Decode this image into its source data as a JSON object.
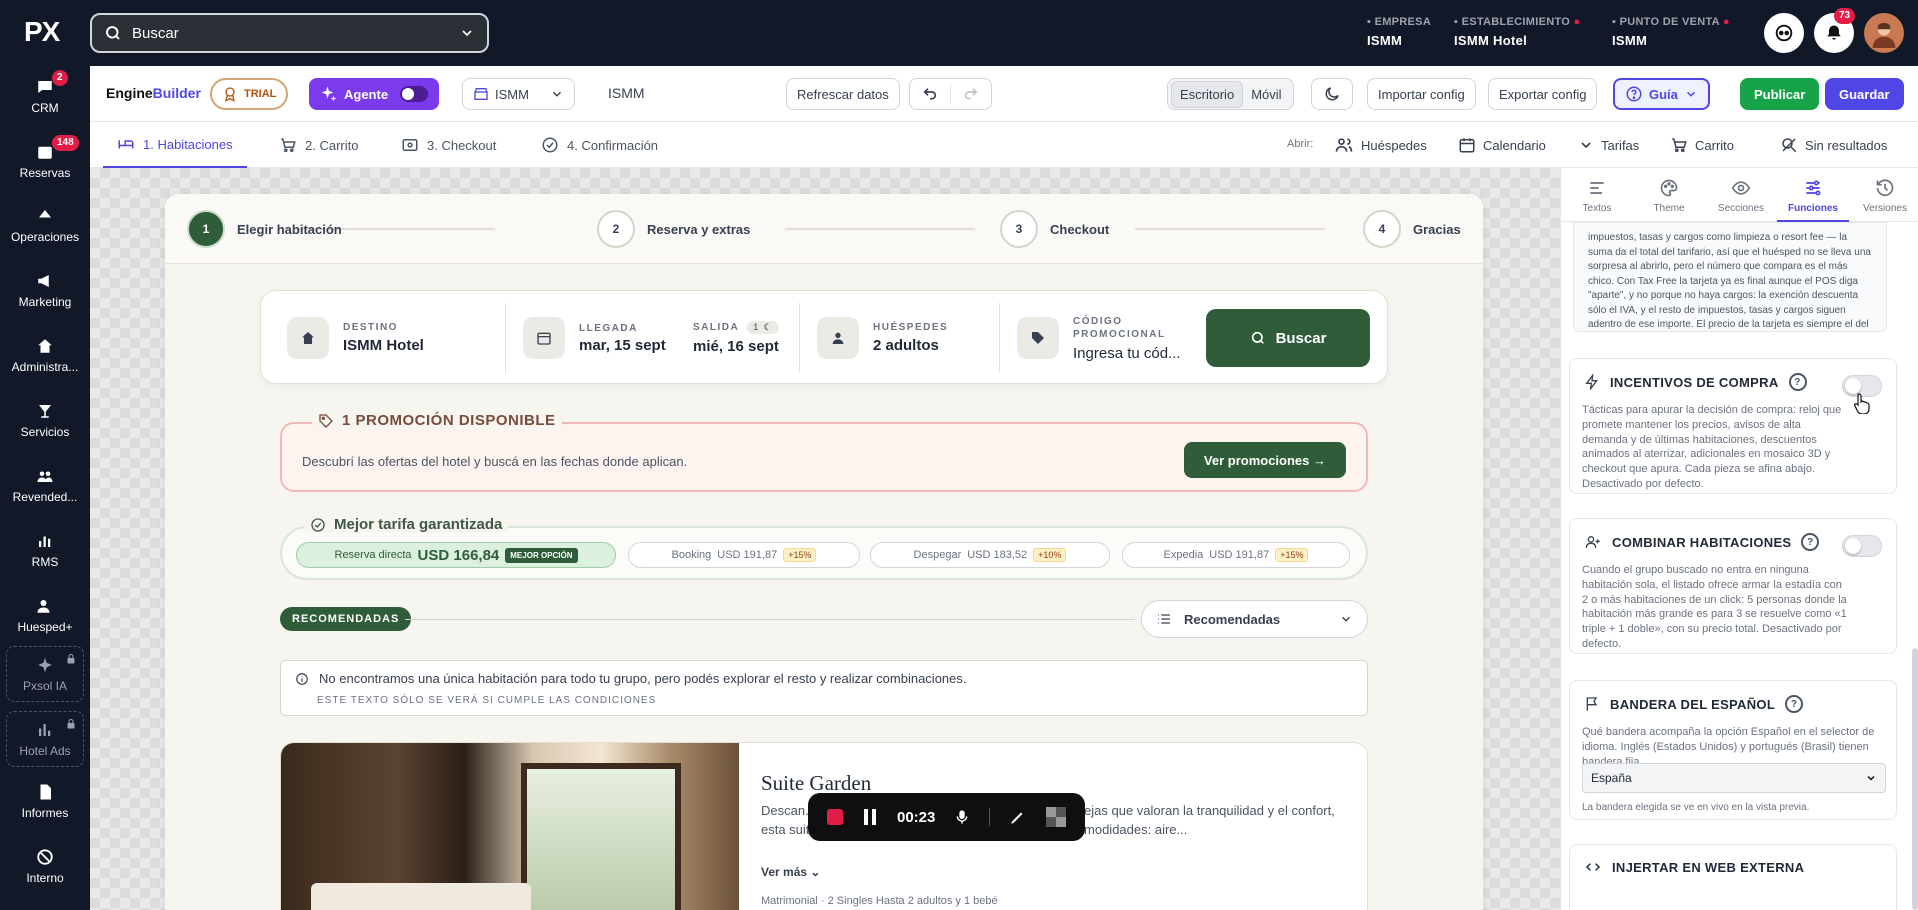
{
  "topbar": {
    "logo": "PX",
    "search_placeholder": "Buscar",
    "empresa_label": "EMPRESA",
    "empresa_value": "ISMM",
    "establecimiento_label": "ESTABLECIMIENTO",
    "establecimiento_value": "ISMM Hotel",
    "pos_label": "PUNTO DE VENTA",
    "pos_value": "ISMM",
    "notifications_count": "73"
  },
  "sidebar": {
    "items": [
      {
        "label": "CRM",
        "badge": "2",
        "icon": "chat-icon"
      },
      {
        "label": "Reservas",
        "badge": "148",
        "icon": "calendar-icon"
      },
      {
        "label": "Operaciones",
        "icon": "bell-icon"
      },
      {
        "label": "Marketing",
        "icon": "megaphone-icon"
      },
      {
        "label": "Administra...",
        "icon": "building-icon"
      },
      {
        "label": "Servicios",
        "icon": "cocktail-icon"
      },
      {
        "label": "Revended...",
        "icon": "users-icon"
      },
      {
        "label": "RMS",
        "icon": "chart-icon"
      },
      {
        "label": "Huesped+",
        "icon": "user-plus-icon"
      },
      {
        "label": "Pxsol IA",
        "icon": "sparkle-icon",
        "locked": true
      },
      {
        "label": "Hotel Ads",
        "icon": "bar-chart-icon",
        "locked": true
      },
      {
        "label": "Informes",
        "icon": "document-icon"
      },
      {
        "label": "Interno",
        "icon": "block-icon"
      }
    ]
  },
  "toolbar": {
    "brand_a": "Engine",
    "brand_b": "Builder",
    "trial": "TRIAL",
    "agent": "Agente",
    "hotel_select": "ISMM",
    "hotel_name": "ISMM",
    "refresh": "Refrescar datos",
    "view_desktop": "Escritorio",
    "view_mobile": "Móvil",
    "import": "Importar config",
    "export": "Exportar config",
    "guide": "Guía",
    "publish": "Publicar",
    "save": "Guardar"
  },
  "stepbar": {
    "tabs": [
      "1. Habitaciones",
      "2. Carrito",
      "3. Checkout",
      "4. Confirmación"
    ],
    "open_label": "Abrir:",
    "open_items": [
      "Huéspedes",
      "Calendario",
      "Tarifas",
      "Carrito",
      "Sin resultados"
    ]
  },
  "preview": {
    "steps": [
      {
        "n": "1",
        "label": "Elegir habitación"
      },
      {
        "n": "2",
        "label": "Reserva y extras"
      },
      {
        "n": "3",
        "label": "Checkout"
      },
      {
        "n": "4",
        "label": "Gracias"
      }
    ],
    "search": {
      "destino_label": "DESTINO",
      "destino_value": "ISMM Hotel",
      "llegada_label": "LLEGADA",
      "llegada_value": "mar, 15 sept",
      "salida_label": "SALIDA",
      "salida_nights": "1",
      "salida_value": "mié, 16 sept",
      "huespedes_label": "HUÉSPEDES",
      "huespedes_value": "2 adultos",
      "codigo_label": "CÓDIGO PROMOCIONAL",
      "codigo_placeholder": "Ingresa tu cód...",
      "button": "Buscar"
    },
    "promo": {
      "title": "1 PROMOCIÓN DISPONIBLE",
      "text": "Descubrí las ofertas del hotel y buscá en las fechas donde aplican.",
      "button": "Ver promociones →"
    },
    "rates": {
      "title": "Mejor tarifa garantizada",
      "direct_label": "Reserva directa",
      "direct_price": "USD 166,84",
      "direct_tag": "MEJOR OPCIÓN",
      "others": [
        {
          "name": "Booking",
          "price": "USD 191,87",
          "pct": "+15%"
        },
        {
          "name": "Despegar",
          "price": "USD 183,52",
          "pct": "+10%"
        },
        {
          "name": "Expedia",
          "price": "USD 191,87",
          "pct": "+15%"
        }
      ]
    },
    "recommended_chip": "RECOMENDADAS",
    "sort_value": "Recomendadas",
    "notice": {
      "line1": "No encontramos una única habitación para todo tu grupo, pero podés explorar el resto y realizar combinaciones.",
      "line2": "ESTE TEXTO SÓLO SE VERÁ SI CUMPLE LAS CONDICIONES"
    },
    "room": {
      "title": "Suite Garden",
      "desc": "Descan... osa habitación de 30 m² con una encant... parejas que valoran la tranquilidad y el confort, esta suite ofrece una atmósfera serena con todas las comodidades: aire...",
      "more": "Ver más",
      "beds": "Matrimonial · 2 Singles   Hasta 2 adultos y 1 bebé"
    },
    "recorder": {
      "time": "00:23"
    }
  },
  "rpanel": {
    "tabs": [
      "Textos",
      "Theme",
      "Secciones",
      "Funciones",
      "Versiones"
    ],
    "taxfree_text": "impuestos, tasas y cargos como limpieza o resort fee — la suma da el total del tarifario, así que el huésped no se lleva una sorpresa al abrirlo, pero el número que compara es el más chico. Con Tax Free la tarjeta ya es final aunque el POS diga \"aparte\", y no porque no haya cargos: la exención descuenta sólo el IVA, y el resto de impuestos, tasas y cargos siguen adentro de ese importe. El precio de la tarjeta es siempre el del tarifario más barato de la habitación (\"desde\"), y lo que se cobra no cambia.",
    "incentivos_title": "INCENTIVOS DE COMPRA",
    "incentivos_text": "Tácticas para apurar la decisión de compra: reloj que promete mantener los precios, avisos de alta demanda y de últimas habitaciones, descuentos animados al aterrizar, adicionales en mosaico 3D y checkout que apura. Cada pieza se afina abajo. Desactivado por defecto.",
    "combinar_title": "COMBINAR HABITACIONES",
    "combinar_text": "Cuando el grupo buscado no entra en ninguna habitación sola, el listado ofrece armar la estadía con 2 o más habitaciones de un click: 5 personas donde la habitación más grande es para 3 se resuelve como «1 triple + 1 doble», con su precio total. Desactivado por defecto.",
    "bandera_title": "BANDERA DEL ESPAÑOL",
    "bandera_text": "Qué bandera acompaña la opción Español en el selector de idioma. Inglés (Estados Unidos) y portugués (Brasil) tienen bandera fija.",
    "bandera_value": "España",
    "bandera_hint": "La bandera elegida se ve en vivo en la vista previa.",
    "injertar_title": "INJERTAR EN WEB EXTERNA"
  }
}
